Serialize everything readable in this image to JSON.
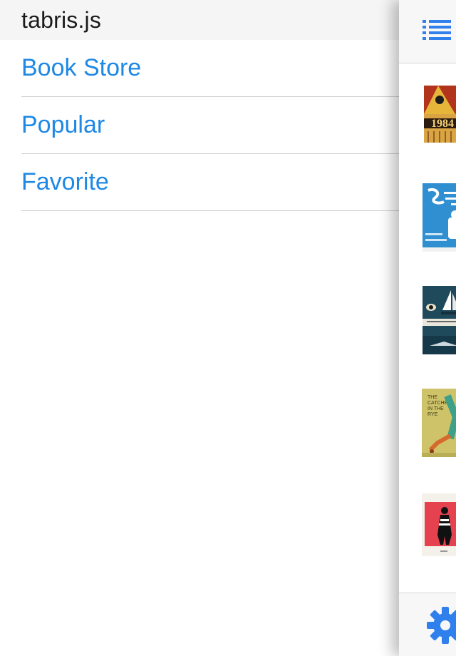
{
  "drawer": {
    "title": "tabris.js",
    "items": [
      {
        "label": "Book Store"
      },
      {
        "label": "Popular"
      },
      {
        "label": "Favorite"
      }
    ]
  },
  "page": {
    "books": [
      {
        "cover_text": "1984"
      },
      {
        "cover_text": ""
      },
      {
        "cover_text": ""
      },
      {
        "cover_text": "THE CATCHER IN THE RYE"
      },
      {
        "cover_text": ""
      }
    ]
  },
  "colors": {
    "accent": "#1e88e5",
    "header_bg": "#f5f5f5",
    "icon_blue": "#2f80ed"
  },
  "icons": {
    "menu_toggle": "list-icon",
    "settings": "gear-icon"
  }
}
